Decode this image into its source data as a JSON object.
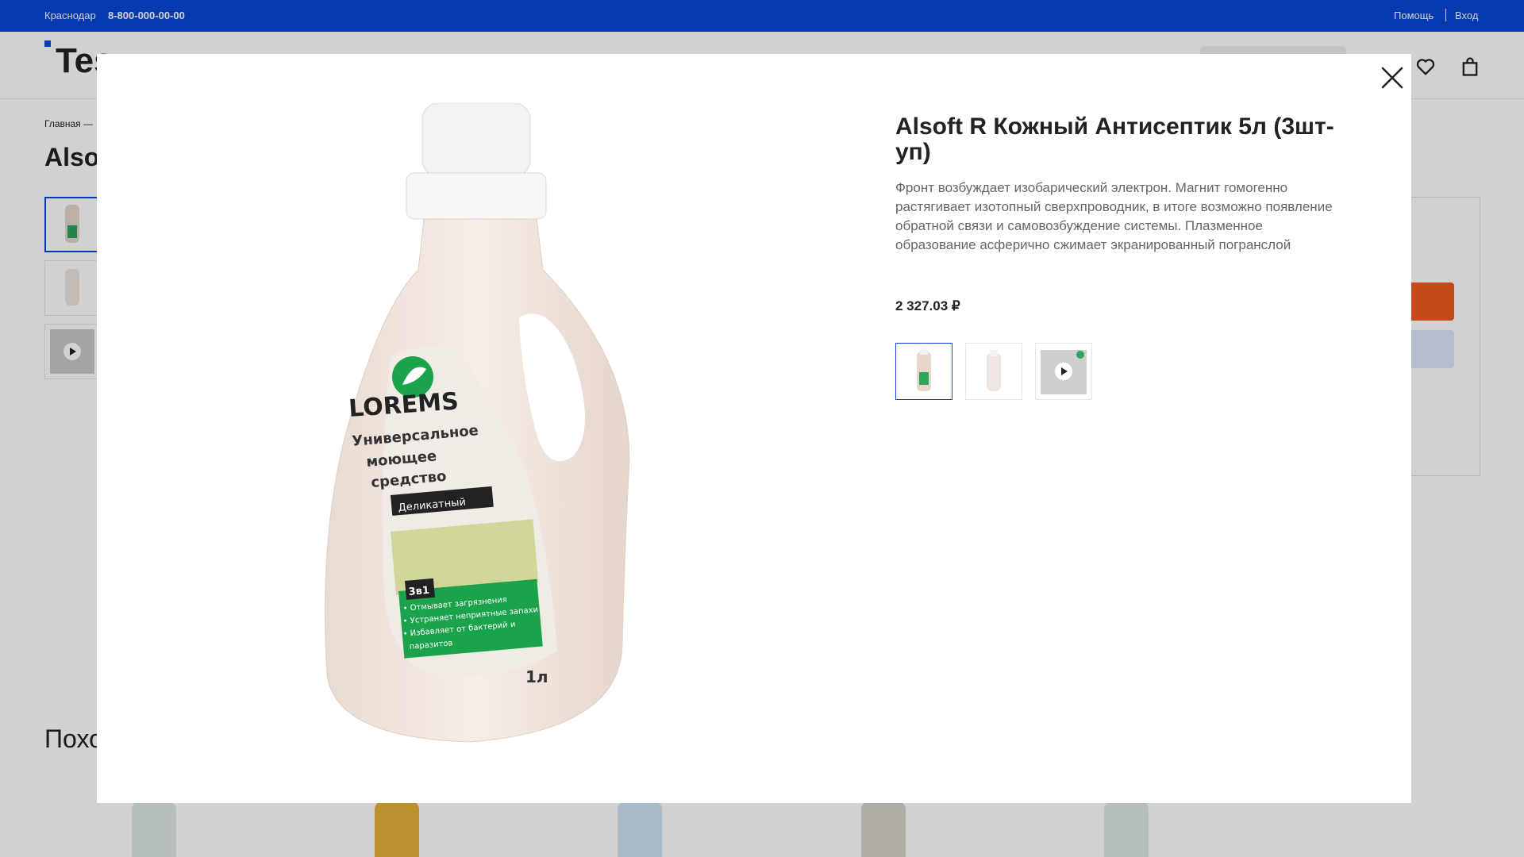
{
  "topbar": {
    "city": "Краснодар",
    "phone": "8-800-000-00-00",
    "help": "Помощь",
    "login": "Вход"
  },
  "header": {
    "logo_text": "Tes"
  },
  "page": {
    "breadcrumb": "Главная —",
    "title_partial": "Also",
    "similar_heading_partial": "Похо"
  },
  "modal": {
    "title": "Alsoft R Кожный Антисептик 5л (3шт-уп)",
    "description": "Фронт возбуждает изобарический электрон. Магнит гомогенно растягивает изотопный сверхпроводник, в итоге возможно появление обратной связи и самовозбуждение системы. Плазменное образование асферично сжимает экранированный погранслой",
    "price": "2 327.03 ₽",
    "thumbnails": [
      {
        "kind": "image",
        "active": true
      },
      {
        "kind": "image",
        "active": false
      },
      {
        "kind": "video",
        "active": false
      }
    ],
    "bottle_label": {
      "brand": "LOREMS",
      "line1": "Универсальное",
      "line2": "моющее",
      "line3": "средство",
      "variant": "Деликатный",
      "badge": "3в1",
      "bullet1": "• Отмывает загрязнения",
      "bullet2": "• Устраняет неприятные запахи",
      "bullet3": "• Избавляет от бактерий и",
      "bullet4": "паразитов",
      "volume": "1л"
    }
  },
  "colors": {
    "brand_blue": "#0a47d6",
    "accent_orange": "#f15a22",
    "label_green": "#1aa34a"
  },
  "icons": [
    "heart-icon",
    "cart-icon",
    "close-icon",
    "play-icon"
  ]
}
